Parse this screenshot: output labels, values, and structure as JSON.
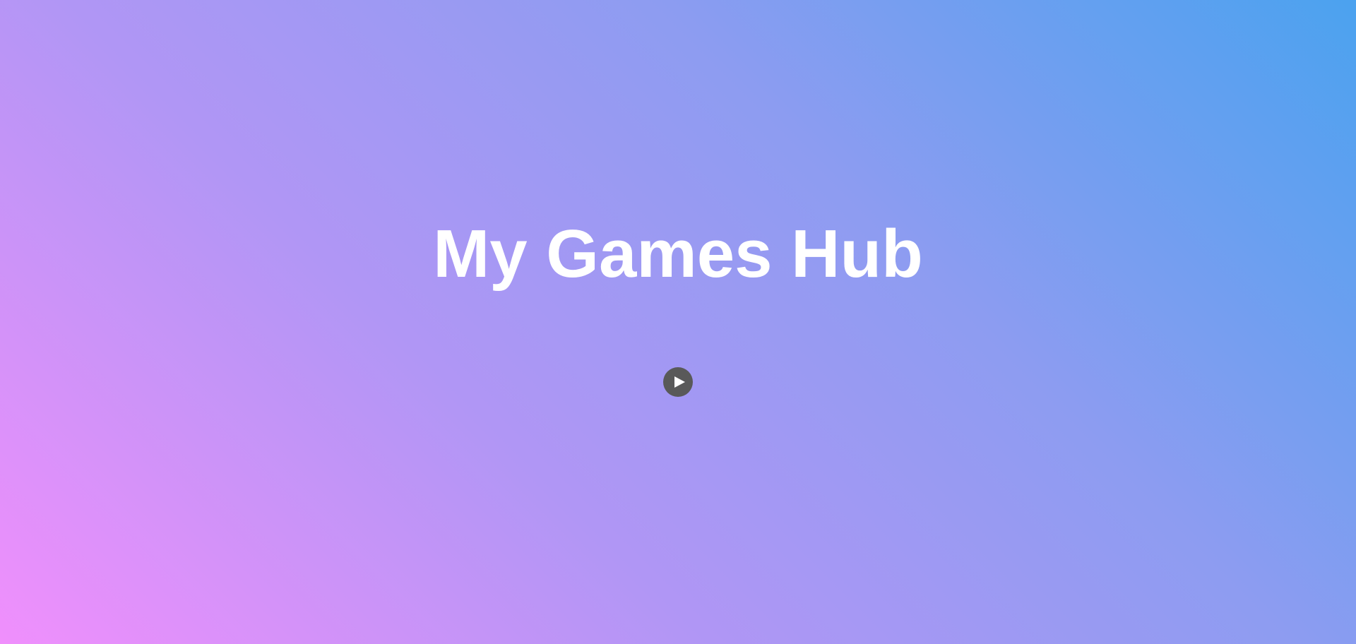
{
  "page": {
    "title": "My Games Hub"
  },
  "play_button": {
    "icon": "play-icon",
    "icon_color": "#ffffff",
    "background_color": "#595959"
  },
  "colors": {
    "gradient_start": "#f08ffc",
    "gradient_end": "#4ba2ef",
    "title_text": "#ffffff"
  }
}
